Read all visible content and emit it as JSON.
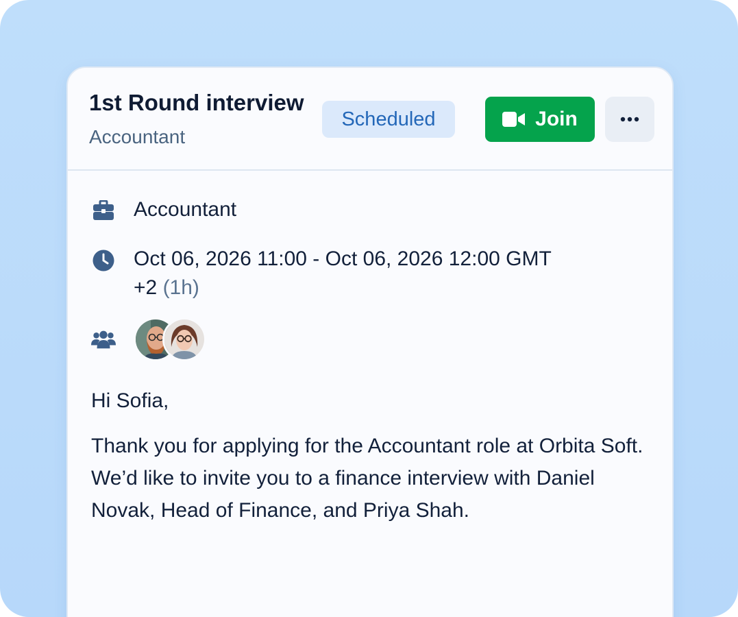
{
  "header": {
    "title": "1st Round interview",
    "subtitle": "Accountant",
    "status": "Scheduled",
    "join_label": "Join",
    "more_icon": "ellipsis-icon"
  },
  "details": {
    "job": "Accountant",
    "datetime_line1": "Oct 06, 2026 11:00 - Oct 06, 2026 12:00 GMT",
    "datetime_line2": "+2",
    "duration": "(1h)",
    "attendees": [
      "avatar-1",
      "avatar-2"
    ]
  },
  "message": {
    "greeting": "Hi Sofia,",
    "body": "Thank you for applying for the Accountant role at Orbita Soft. We’d like to invite you to a finance interview with Daniel Novak, Head of Finance, and Priya Shah."
  },
  "colors": {
    "background": "#bfdefb",
    "join": "#05a34c",
    "badge_bg": "#dbe9fb",
    "badge_text": "#2367b8",
    "icon": "#3d5f8a"
  }
}
